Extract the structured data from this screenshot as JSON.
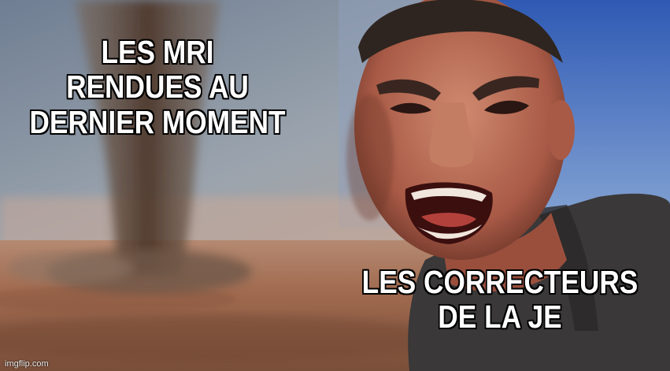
{
  "meme": {
    "top_caption": "LES MRI\nRENDUES AU\nDERNIER MOMENT",
    "bottom_caption": "LES CORRECTEURS\nDE LA JE",
    "watermark": "imgflip.com"
  },
  "colors": {
    "sky_top": "#7a8a9e",
    "sky_right": "#3f64b8",
    "ground": "#9a6a4c",
    "tornado": "#5c4234",
    "skin": "#b46a55",
    "shirt": "#3a3838"
  }
}
